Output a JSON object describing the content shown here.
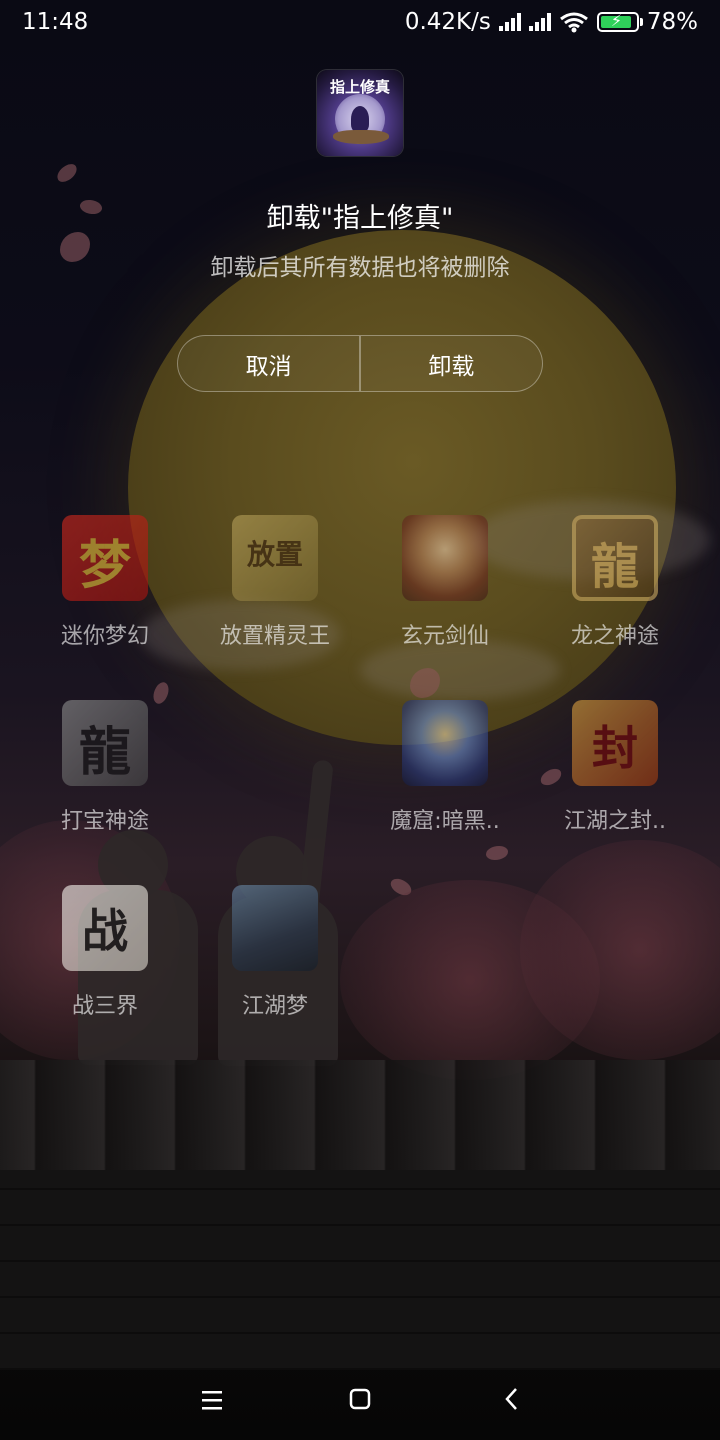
{
  "status_bar": {
    "time": "11:48",
    "network_speed": "0.42K/s",
    "battery_percent": "78%",
    "battery_level": 0.78
  },
  "dialog": {
    "app_icon": "xiuzhen-app-icon",
    "app_icon_text": "指上修真",
    "title": "卸载\"指上修真\"",
    "subtitle": "卸载后其所有数据也将被删除",
    "cancel_label": "取消",
    "uninstall_label": "卸载"
  },
  "apps": [
    {
      "label": "迷你梦幻",
      "icon": "mini-menghuan-icon",
      "glyph": "梦"
    },
    {
      "label": "放置精灵王",
      "icon": "fangzhi-jinglingwang-icon",
      "glyph": "放置"
    },
    {
      "label": "玄元剑仙",
      "icon": "xuanyuan-jianxian-icon",
      "glyph": ""
    },
    {
      "label": "龙之神途",
      "icon": "long-shentu-icon",
      "glyph": "龍"
    },
    {
      "label": "打宝神途",
      "icon": "dabao-shentu-icon",
      "glyph": "龍"
    },
    {
      "label": "魔窟:暗黑..",
      "icon": "moku-anhei-icon",
      "glyph": ""
    },
    {
      "label": "江湖之封..",
      "icon": "jianghu-feng-icon",
      "glyph": "封"
    },
    {
      "label": "战三界",
      "icon": "zhan-sanjie-icon",
      "glyph": "战"
    },
    {
      "label": "江湖梦",
      "icon": "jianghu-meng-icon",
      "glyph": ""
    }
  ],
  "nav_bar": {
    "menu_icon": "menu-icon",
    "home_icon": "home-icon",
    "back_icon": "back-icon"
  }
}
